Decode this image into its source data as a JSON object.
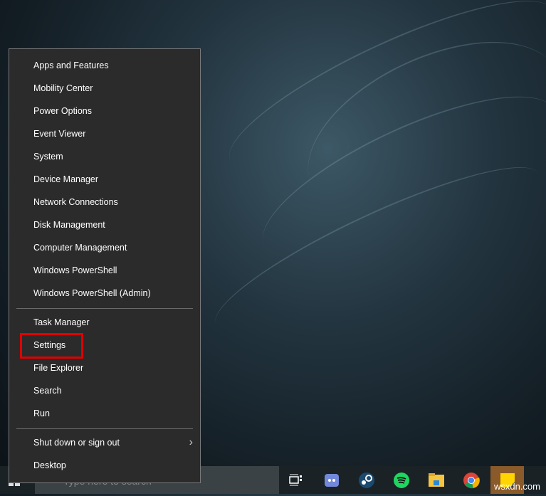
{
  "menu": {
    "items": [
      "Apps and Features",
      "Mobility Center",
      "Power Options",
      "Event Viewer",
      "System",
      "Device Manager",
      "Network Connections",
      "Disk Management",
      "Computer Management",
      "Windows PowerShell",
      "Windows PowerShell (Admin)"
    ],
    "group2": [
      "Task Manager",
      "Settings",
      "File Explorer",
      "Search",
      "Run"
    ],
    "group3": [
      "Shut down or sign out",
      "Desktop"
    ],
    "highlighted": "Settings",
    "highlight_color": "#e00000"
  },
  "taskbar": {
    "search_placeholder": "Type here to search",
    "icons": [
      "task-view",
      "discord",
      "steam",
      "spotify",
      "file-explorer",
      "chrome",
      "sticky-notes"
    ]
  },
  "watermark": "wsxdn.com"
}
